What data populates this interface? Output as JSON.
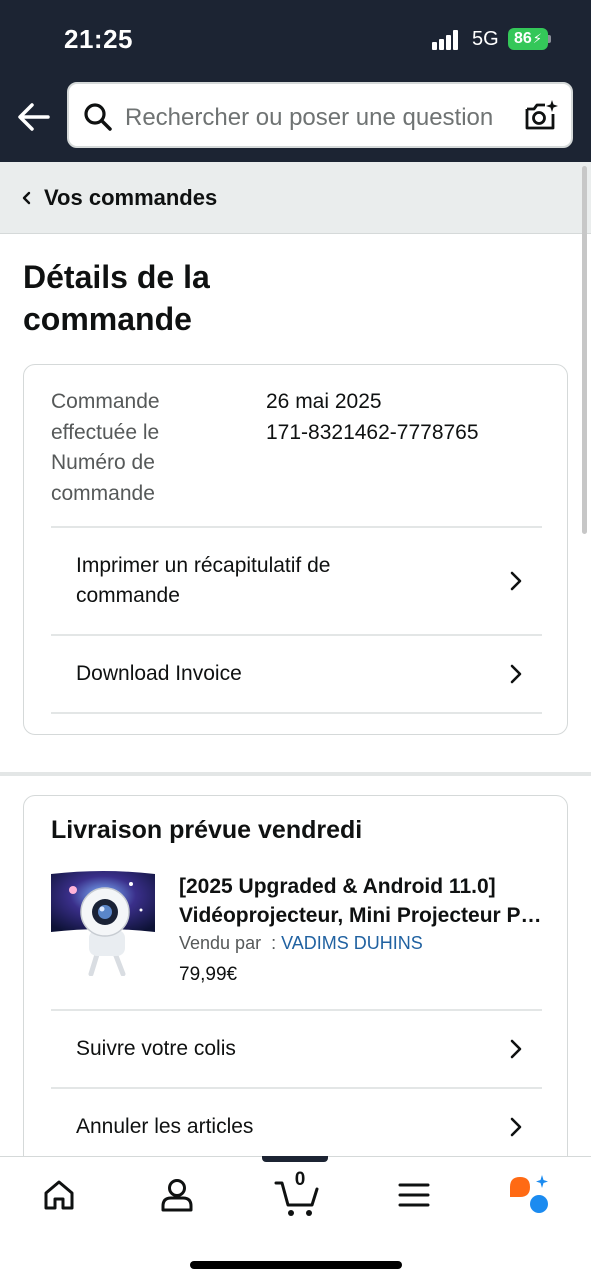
{
  "status_bar": {
    "time": "21:25",
    "network": "5G",
    "battery": "86"
  },
  "search": {
    "placeholder": "Rechercher ou poser une question"
  },
  "breadcrumb": {
    "label": "Vos commandes"
  },
  "page": {
    "title": "Détails de la commande"
  },
  "order": {
    "labels": [
      "Commande effectuée le",
      "Numéro de commande"
    ],
    "date": "26 mai 2025",
    "number": "171-8321462-7778765",
    "actions": [
      "Imprimer un récapitulatif de commande",
      "Download Invoice"
    ]
  },
  "delivery": {
    "title": "Livraison prévue vendredi",
    "product": {
      "title_line1": "[2025 Upgraded & Android 11.0]",
      "title_line2": "Vidéoprojecteur, Mini Projecteur Portable",
      "seller_prefix": "Vendu par  : ",
      "seller_name": "VADIMS DUHINS",
      "price": "79,99€"
    },
    "actions": [
      "Suivre votre colis",
      "Annuler les articles"
    ]
  },
  "bottom_nav": {
    "cart_count": "0"
  },
  "colors": {
    "header": "#1c2433",
    "link": "#2162a1",
    "battery": "#34c759",
    "assistant_orange": "#ff6a14",
    "assistant_blue": "#1b8bf0"
  }
}
